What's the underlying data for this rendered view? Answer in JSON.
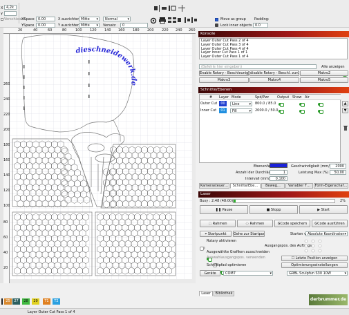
{
  "toolbar": {
    "x_label": "X",
    "x_value": "4,2k",
    "y_label": "Y",
    "lock_label": "Verschieben",
    "xspace_label": "XSpace",
    "xspace_value": "0.00",
    "yspace_label": "YSpace",
    "yspace_value": "0.00",
    "x_align_label": "X ausrichten",
    "x_align_value": "Mitte",
    "y_align_label": "Y ausrichten",
    "y_align_value": "Mitte",
    "mode_value": "Normal",
    "versatz_label": "Versatz",
    "versatz_value": "0",
    "move_group_label": "Move as group",
    "lock_inner_label": "Lock inner objects",
    "padding_label": "Padding:",
    "padding_value": "0.0"
  },
  "ruler": {
    "top": [
      "20",
      "40",
      "60",
      "80",
      "100",
      "120",
      "140",
      "160",
      "180",
      "200",
      "220",
      "240",
      "260"
    ],
    "left": [
      "20",
      "40",
      "60",
      "80",
      "100",
      "120",
      "140",
      "160",
      "180",
      "200",
      "220",
      "240",
      "260"
    ]
  },
  "canvas": {
    "engraved_text": "dieschneidewerk.de"
  },
  "konsole": {
    "title": "Konsole",
    "lines": [
      "Layer Outer Cut Pass 2 of 4",
      "Layer Outer Cut Pass 3 of 4",
      "Layer Outer Cut Pass 4 of 4",
      "Layer Inner Cut Pass 1 of 1",
      "Layer Outer Cut Pass 1 of 4"
    ],
    "input_placeholder": "(Befehle hier eingeben)",
    "all_anzeigen": "Alle anzeigen",
    "buttons": [
      "Enable Rotary - Beschleunigung",
      "disable Rotary - Beschl. zurücksetzen",
      "Makro2",
      "Makro3",
      "Makro4",
      "Makro5"
    ]
  },
  "schnitte": {
    "title": "Schnitte/Ebenen",
    "headers": [
      "#",
      "Layer",
      "Mode",
      "Spd/Pwr",
      "Output",
      "Show",
      "Air"
    ],
    "rows": [
      {
        "name": "Outer Cut",
        "layer": "00",
        "layer_color": "#1f3fd0",
        "mode": "Line",
        "spdpwr": "800.0 / 85.0"
      },
      {
        "name": "Inner Cut",
        "layer": "01",
        "layer_color": "#1f8fe0",
        "mode": "Fill",
        "spdpwr": "2000.0 / 50.0"
      }
    ],
    "ebenenfarbe": "Ebenenfarbe",
    "ebenenfarbe_color": "#1b22d8",
    "geschwindigkeit_label": "Geschwindigkeit (mm/m)",
    "geschwindigkeit_value": "2000",
    "durchlaeufe_label": "Anzahl der Durchläufe",
    "durchlaeufe_value": "1",
    "leistung_label": "Leistung Max (%)",
    "leistung_value": "50,00",
    "intervall_label": "Intervall (mm)",
    "intervall_value": "0,100"
  },
  "tabs1": [
    "Kamerasteuer…",
    "Schnitte/Ebe…",
    "Beweg…",
    "Variabler T…",
    "Form-Eigenschaf…"
  ],
  "laser": {
    "title": "Laser",
    "status": "Busy : 2:48 (48:00)",
    "progress_percent": 2,
    "progress_label": "2%",
    "pause": "Pause",
    "stop": "Stopp",
    "start": "Start",
    "rahmen1": "Rahmen",
    "rahmen2": "Rahmen",
    "gcode_save": "GCode speichern",
    "gcode_run": "GCode ausführen",
    "startpunkt": "Startpunkt",
    "gehe_startpos": "Gehe zur Startpos.",
    "starten_von_label": "Starten von:",
    "starten_von_value": "Absolute Koordinaten",
    "rotary": "Rotary aktivieren",
    "auftrag_label": "Ausgangspos. des Auftrags",
    "ausgewaehlte": "Ausgewählte Grafiken ausschneiden",
    "auswahl": "Auswahlausgangspos. verwenden",
    "letzte": "Letzte Position anzeigen",
    "schnittpfad": "Schnittpfad optimieren",
    "opt_settings": "Optimierungseinstellungen",
    "geraete": "Geräte",
    "port": "COM7",
    "device": "GRBL Sculpfun S30 10W"
  },
  "tabs2": [
    "Laser",
    "Bibliothek"
  ],
  "palette": [
    {
      "label": "25",
      "color": "#d98a30"
    },
    {
      "label": "27",
      "color": "#2c6060"
    },
    {
      "label": "28",
      "color": "#40b840"
    },
    {
      "label": "29",
      "color": "#e0d020"
    },
    {
      "label": "T1",
      "color": "#e08020"
    },
    {
      "label": "T2",
      "color": "#2aa0e0"
    }
  ],
  "status_bar": "Layer Outer Cut Pass 1 of 4",
  "logo": "derbrummer.de"
}
